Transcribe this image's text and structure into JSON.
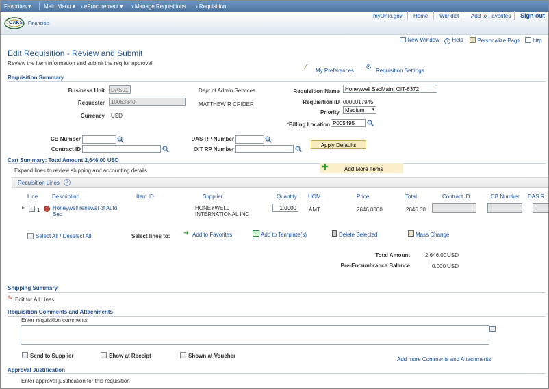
{
  "nav": {
    "favorites": "Favorites",
    "main_menu": "Main Menu",
    "eprocurement": "eProcurement",
    "manage_requisitions": "Manage Requisitions",
    "requisition": "Requisition"
  },
  "header": {
    "logo_text": "OAKS",
    "logo_sub": "Financials",
    "links": [
      "myOhio.gov",
      "Home",
      "Worklist",
      "Add to Favorites"
    ],
    "signout": "Sign out"
  },
  "toolbar": {
    "new_window": "New Window",
    "help": "Help",
    "personalize_page": "Personalize Page",
    "http": "http"
  },
  "page": {
    "title": "Edit Requisition  - Review and Submit",
    "subtitle": "Review the item information and submit the req for approval.",
    "my_preferences": "My Preferences",
    "requisition_settings": "Requisition Settings"
  },
  "summary": {
    "heading": "Requisition Summary",
    "business_unit_label": "Business Unit",
    "business_unit_value": "DAS01",
    "business_unit_desc": "Dept of Admin Services",
    "requester_label": "Requester",
    "requester_value": "10063840",
    "requester_name": "MATTHEW R CRIDER",
    "currency_label": "Currency",
    "currency_value": "USD",
    "req_name_label": "Requisition Name",
    "req_name_value": "Honeywell SecMaint OIT-6372",
    "req_id_label": "Requisition ID",
    "req_id_value": "0000017945",
    "priority_label": "Priority",
    "priority_value": "Medium",
    "billing_label": "*Billing Location",
    "billing_value": "P005495",
    "cb_number_label": "CB Number",
    "contract_id_label": "Contract ID",
    "das_rp_label": "DAS RP Number",
    "oit_rp_label": "OIT RP Number",
    "apply_defaults": "Apply Defaults"
  },
  "cart": {
    "heading": "Cart Summary: Total Amount 2,646.00 USD",
    "expand_text": "Expand lines to review shipping and accounting details",
    "add_more_items": "Add More Items",
    "lines_heading": "Requisition Lines",
    "columns": [
      "Line",
      "Description",
      "Item ID",
      "Supplier",
      "Quantity",
      "UOM",
      "Price",
      "Total",
      "Contract ID",
      "CB Number",
      "DAS R"
    ],
    "row": {
      "line": "1",
      "description_1": "Honeywell renewal of Auto",
      "description_2": "Sec",
      "supplier_1": "HONEYWELL",
      "supplier_2": "INTERNATIONAL INC",
      "quantity": "1.0000",
      "uom": "AMT",
      "price": "2646.0000",
      "total": "2646.00"
    },
    "select_all": "Select All / Deselect All",
    "select_lines_to": "Select lines to:",
    "add_to_favorites": "Add to Favorites",
    "add_to_templates": "Add to Template(s)",
    "delete_selected": "Delete Selected",
    "mass_change": "Mass Change",
    "total_amount_label": "Total Amount",
    "total_amount_value": "2,646.00",
    "total_amount_cur": "USD",
    "pre_enc_label": "Pre-Encumbrance Balance",
    "pre_enc_value": "0.000",
    "pre_enc_cur": "USD"
  },
  "shipping": {
    "heading": "Shipping Summary",
    "edit_all": "Edit for All Lines"
  },
  "comments": {
    "heading": "Requisition Comments and Attachments",
    "prompt": "Enter requisition comments",
    "send_to_supplier": "Send to Supplier",
    "show_at_receipt": "Show at Receipt",
    "shown_at_voucher": "Shown at Voucher",
    "add_more": "Add more Comments and Attachments"
  },
  "approval": {
    "heading": "Approval Justification",
    "prompt": "Enter approval justification for this requisition"
  }
}
